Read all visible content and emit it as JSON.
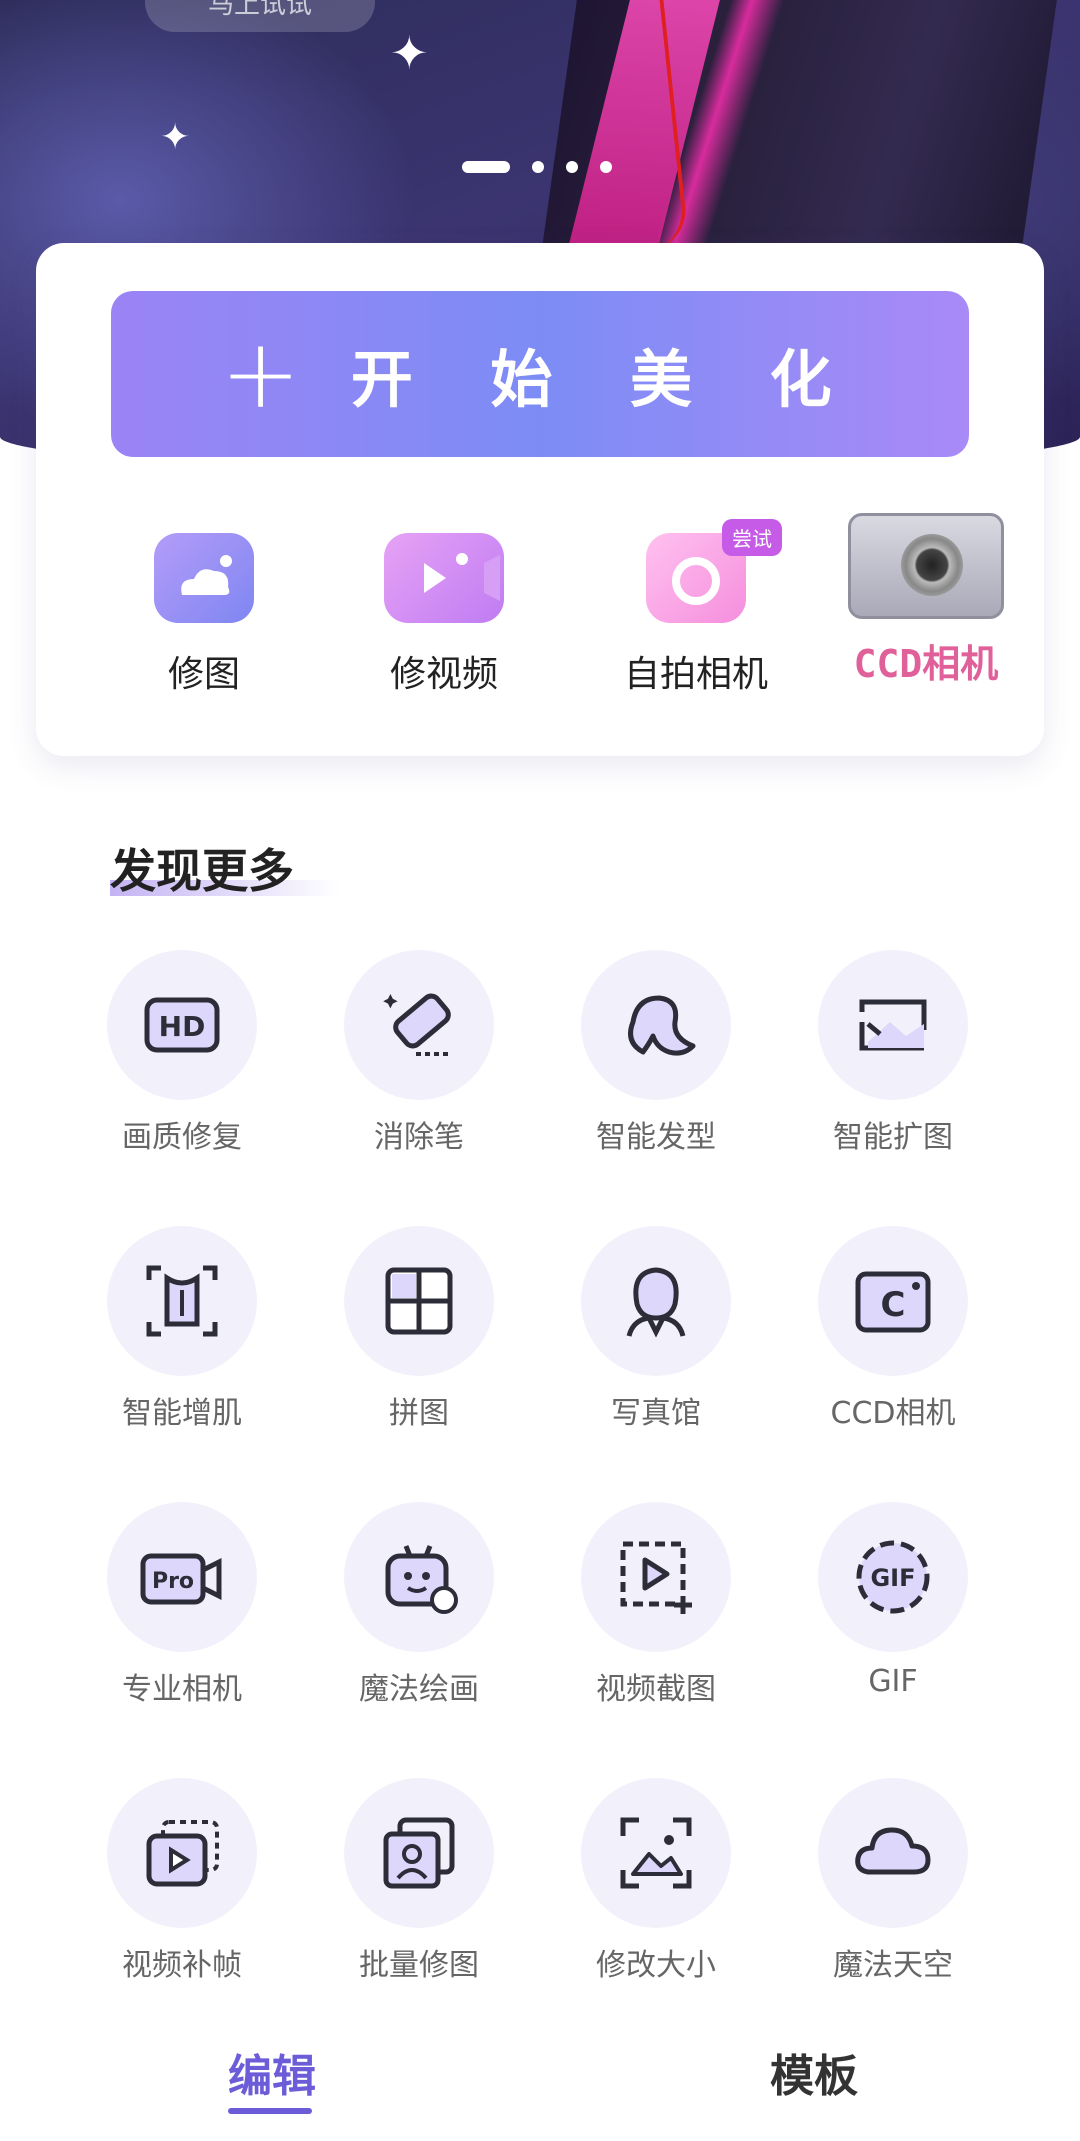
{
  "banner": {
    "chip_text": "马上试试",
    "page_indicator": {
      "count": 4,
      "active": 1
    }
  },
  "card": {
    "start_button": {
      "plus": "+",
      "label": "开 始 美 化"
    },
    "quick_actions": [
      {
        "label": "修图",
        "icon": "photo-icon"
      },
      {
        "label": "修视频",
        "icon": "video-camera-icon"
      },
      {
        "label": "自拍相机",
        "icon": "camera-icon",
        "badge": "尝试"
      },
      {
        "label": "CCD相机",
        "icon": "ccd-camera-icon"
      }
    ]
  },
  "discover": {
    "title": "发现更多",
    "tools": [
      {
        "label": "画质修复",
        "icon": "hd-icon"
      },
      {
        "label": "消除笔",
        "icon": "eraser-icon"
      },
      {
        "label": "智能发型",
        "icon": "hair-icon"
      },
      {
        "label": "智能扩图",
        "icon": "expand-image-icon"
      },
      {
        "label": "智能增肌",
        "icon": "body-icon"
      },
      {
        "label": "拼图",
        "icon": "collage-icon"
      },
      {
        "label": "写真馆",
        "icon": "portrait-icon"
      },
      {
        "label": "CCD相机",
        "icon": "ccd-icon"
      },
      {
        "label": "专业相机",
        "icon": "pro-camera-icon"
      },
      {
        "label": "魔法绘画",
        "icon": "robot-paint-icon"
      },
      {
        "label": "视频截图",
        "icon": "video-capture-icon"
      },
      {
        "label": "GIF",
        "icon": "gif-icon"
      },
      {
        "label": "视频补帧",
        "icon": "frames-icon"
      },
      {
        "label": "批量修图",
        "icon": "batch-icon"
      },
      {
        "label": "修改大小",
        "icon": "resize-icon"
      },
      {
        "label": "魔法天空",
        "icon": "cloud-icon"
      }
    ]
  },
  "tabs": [
    {
      "label": "编辑",
      "active": true
    },
    {
      "label": "模板",
      "active": false
    }
  ],
  "colors": {
    "accent": "#6c5cd8",
    "button_start": "#9b84f5",
    "button_end": "#a98af7"
  }
}
